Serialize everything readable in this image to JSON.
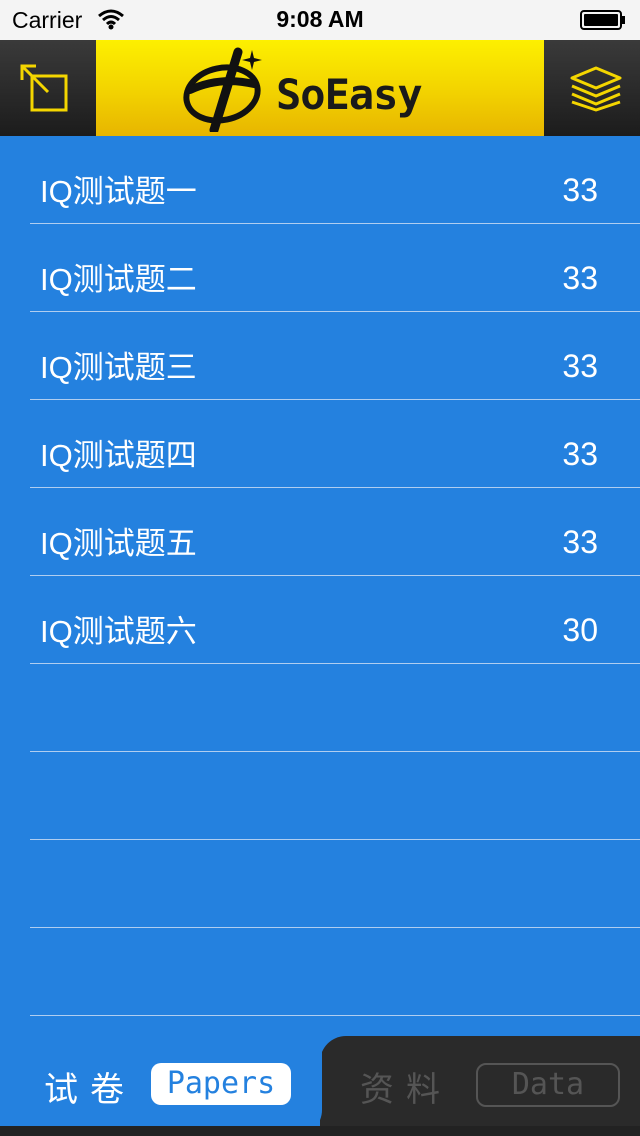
{
  "status_bar": {
    "carrier": "Carrier",
    "time": "9:08 AM"
  },
  "header": {
    "left_icon": "expand-icon",
    "right_icon": "layers-icon",
    "logo_text": "SoEasy",
    "brand_color": "#f4d600"
  },
  "list": {
    "items": [
      {
        "title": "IQ测试题一",
        "count": "33"
      },
      {
        "title": "IQ测试题二",
        "count": "33"
      },
      {
        "title": "IQ测试题三",
        "count": "33"
      },
      {
        "title": "IQ测试题四",
        "count": "33"
      },
      {
        "title": "IQ测试题五",
        "count": "33"
      },
      {
        "title": "IQ测试题六",
        "count": "30"
      }
    ],
    "background_color": "#2481df"
  },
  "tabbar": {
    "tabs": [
      {
        "cn": "试卷",
        "en": "Papers",
        "active": true
      },
      {
        "cn": "资料",
        "en": "Data",
        "active": false
      }
    ]
  }
}
